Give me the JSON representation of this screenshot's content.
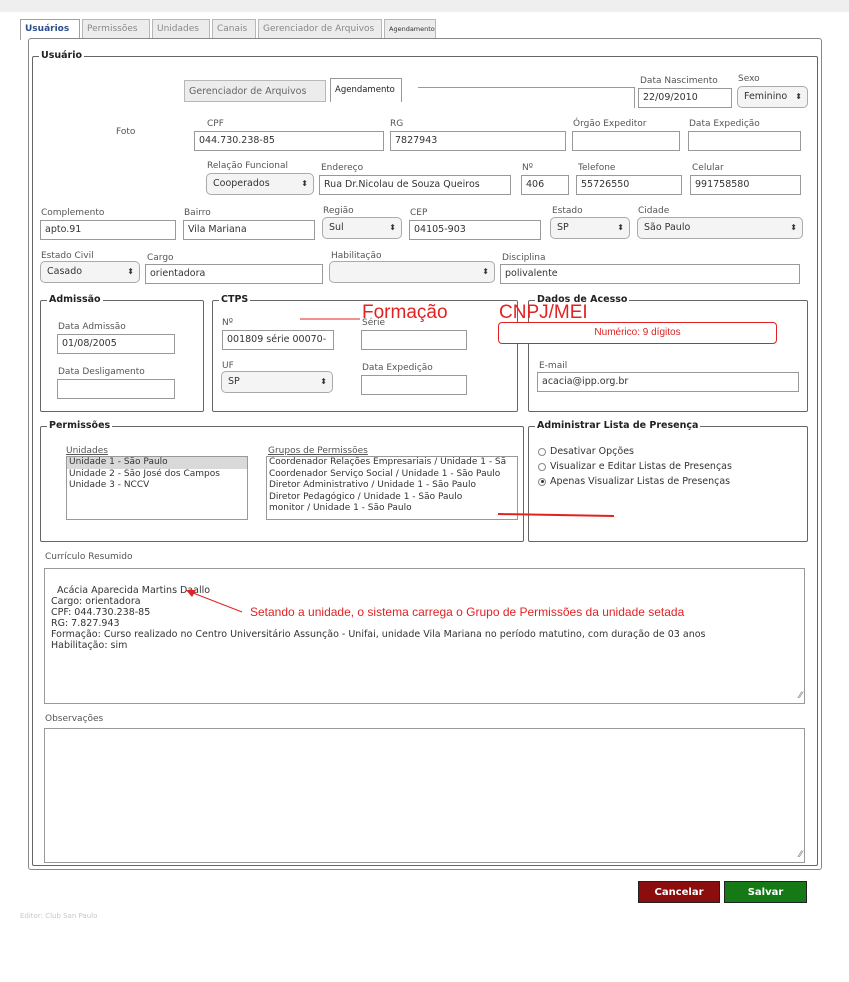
{
  "tabs": [
    "Usuários",
    "Permissões",
    "Unidades",
    "Canais",
    "Gerenciador de Arquivos",
    "Agendamento"
  ],
  "active_tab": "Usuários",
  "usuario": {
    "legend": "Usuário",
    "popup_tabs": [
      "Gerenciador de Arquivos",
      "Agendamento"
    ],
    "foto_label": "Foto",
    "data_nascimento": {
      "label": "Data Nascimento",
      "value": "22/09/2010"
    },
    "sexo": {
      "label": "Sexo",
      "value": "Feminino"
    },
    "cpf": {
      "label": "CPF",
      "value": "044.730.238-85"
    },
    "rg": {
      "label": "RG",
      "value": "7827943"
    },
    "orgao_expeditor": {
      "label": "Órgão Expeditor",
      "value": ""
    },
    "data_expedicao": {
      "label": "Data Expedição",
      "value": ""
    },
    "relacao_funcional": {
      "label": "Relação Funcional",
      "value": "Cooperados"
    },
    "endereco": {
      "label": "Endereço",
      "value": "Rua Dr.Nicolau de Souza Queiros"
    },
    "numero": {
      "label": "Nº",
      "value": "406"
    },
    "telefone": {
      "label": "Telefone",
      "value": "55726550"
    },
    "celular": {
      "label": "Celular",
      "value": "991758580"
    },
    "complemento": {
      "label": "Complemento",
      "value": "apto.91"
    },
    "bairro": {
      "label": "Bairro",
      "value": "Vila Mariana"
    },
    "regiao": {
      "label": "Região",
      "value": "Sul"
    },
    "cep": {
      "label": "CEP",
      "value": "04105-903"
    },
    "estado": {
      "label": "Estado",
      "value": "SP"
    },
    "cidade": {
      "label": "Cidade",
      "value": "São Paulo"
    },
    "estado_civil": {
      "label": "Estado Civil",
      "value": "Casado"
    },
    "cargo": {
      "label": "Cargo",
      "value": "orientadora"
    },
    "habilitacao": {
      "label": "Habilitação",
      "value": ""
    },
    "disciplina": {
      "label": "Disciplina",
      "value": "polivalente"
    }
  },
  "admissao": {
    "legend": "Admissão",
    "data_admissao": {
      "label": "Data Admissão",
      "value": "01/08/2005"
    },
    "data_desligamento": {
      "label": "Data Desligamento",
      "value": ""
    }
  },
  "ctps": {
    "legend": "CTPS",
    "numero": {
      "label": "Nº",
      "value": "001809 série 00070-"
    },
    "serie": {
      "label": "Série",
      "value": ""
    },
    "uf": {
      "label": "UF",
      "value": "SP"
    },
    "data_expedicao": {
      "label": "Data Expedição",
      "value": ""
    }
  },
  "dados_acesso": {
    "legend": "Dados de Acesso",
    "email": {
      "label": "E-mail",
      "value": "acacia@ipp.org.br"
    }
  },
  "permissoes": {
    "legend": "Permissões",
    "unidades_label": "Unidades",
    "unidades": [
      "Unidade 1 - São Paulo",
      "Unidade 2 - São José dos Campos",
      "Unidade 3 - NCCV"
    ],
    "grupos_label": "Grupos de Permissões",
    "grupos": [
      "Coordenador Relações Empresariais / Unidade 1 - Sã",
      "Coordenador Serviço Social / Unidade 1 - São Paulo",
      "Diretor Administrativo / Unidade 1 - São Paulo",
      "Diretor Pedagógico / Unidade 1 - São Paulo",
      "monitor / Unidade 1 - São Paulo"
    ]
  },
  "lista_presenca": {
    "legend": "Administrar Lista de Presença",
    "options": [
      "Desativar Opções",
      "Visualizar e Editar Listas de Presenças",
      "Apenas Visualizar Listas de Presenças"
    ],
    "selected_index": 2
  },
  "curriculo": {
    "label": "Currículo Resumido",
    "text": "Acácia Aparecida Martins Daallo\nCargo: orientadora\nCPF: 044.730.238-85\nRG: 7.827.943\nFormação: Curso realizado no Centro Universitário Assunção - Unifai, unidade Vila Mariana no período matutino, com duração de 03 anos\nHabilitação: sim"
  },
  "observacoes": {
    "label": "Observações",
    "text": ""
  },
  "buttons": {
    "cancel": "Cancelar",
    "save": "Salvar"
  },
  "annotations": {
    "formacao": "Formação",
    "cnpj": "CNPJ/MEI",
    "numerico": "Numérico: 9 dígitos",
    "setando": "Setando a unidade, o sistema carrega o Grupo de Permissões da unidade setada"
  },
  "footer": "Editor: Club San Paulo",
  "colors": {
    "annotation": "#e22222",
    "cancel": "#8b0d0d",
    "save": "#157a16",
    "tab_active_text": "#2c4e8a"
  }
}
